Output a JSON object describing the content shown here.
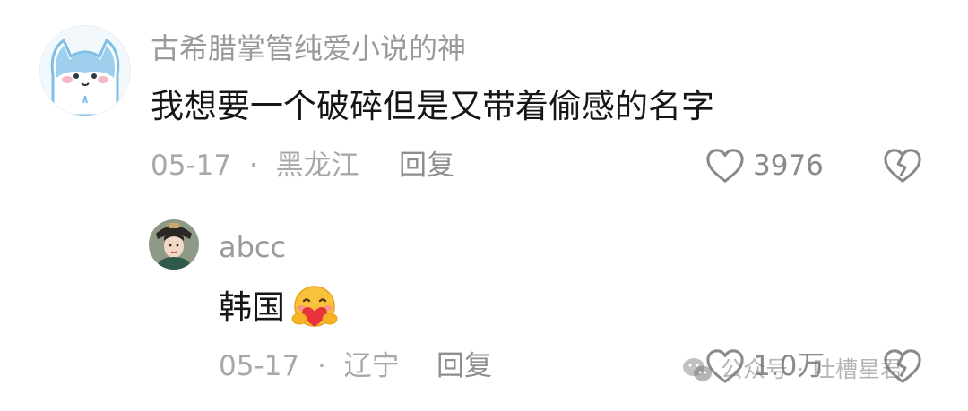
{
  "comment": {
    "username": "古希腊掌管纯爱小说的神",
    "text": "我想要一个破碎但是又带着偷感的名字",
    "date": "05-17",
    "dot": "·",
    "location": "黑龙江",
    "reply_label": "回复",
    "like_count": "3976"
  },
  "reply": {
    "username": "abcc",
    "text": "韩国",
    "date": "05-17",
    "dot": "·",
    "location": "辽宁",
    "reply_label": "回复",
    "like_count": "1.0万"
  },
  "watermark": {
    "label": "公众号",
    "separator": "·",
    "name": "吐槽星君"
  },
  "colors": {
    "avatar_cat_fill": "#9ed0ee",
    "emoji_yellow": "#f9c23c",
    "heart_red": "#e8323c",
    "meta_gray": "#a8a8a8"
  },
  "icons": {
    "like": "heart-outline-icon",
    "dislike": "broken-heart-icon",
    "emoji": "hugging-heart-emoji",
    "watermark": "wechat-icon"
  }
}
